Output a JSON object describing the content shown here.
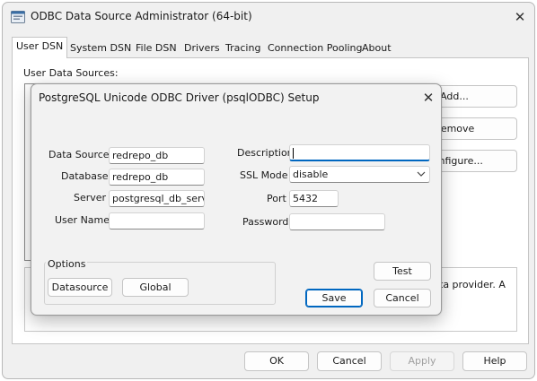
{
  "window": {
    "title": "ODBC Data Source Administrator (64-bit)",
    "close_glyph": "✕"
  },
  "tabs": [
    {
      "label": "User DSN"
    },
    {
      "label": "System DSN"
    },
    {
      "label": "File DSN"
    },
    {
      "label": "Drivers"
    },
    {
      "label": "Tracing"
    },
    {
      "label": "Connection Pooling"
    },
    {
      "label": "About"
    }
  ],
  "user_dsn": {
    "list_label": "User Data Sources:",
    "buttons": {
      "add_label": "Add...",
      "remove_label": "Remove",
      "configure_label": "Configure..."
    },
    "info_text_partial": "ta provider.  A"
  },
  "footer": {
    "ok_label": "OK",
    "cancel_label": "Cancel",
    "apply_label": "Apply",
    "help_label": "Help"
  },
  "dialog": {
    "title": "PostgreSQL Unicode ODBC Driver (psqlODBC) Setup",
    "close_glyph": "✕",
    "fields": {
      "data_source": {
        "label": "Data Source",
        "value": "redrepo_db"
      },
      "database": {
        "label": "Database",
        "value": "redrepo_db"
      },
      "server": {
        "label": "Server",
        "value": "postgresql_db_server"
      },
      "user_name": {
        "label": "User Name",
        "value": ""
      },
      "description": {
        "label": "Description",
        "value": ""
      },
      "ssl_mode": {
        "label": "SSL Mode",
        "value": "disable"
      },
      "port": {
        "label": "Port",
        "value": "5432"
      },
      "password": {
        "label": "Password",
        "value": ""
      }
    },
    "options": {
      "group_label": "Options",
      "datasource_label": "Datasource",
      "global_label": "Global"
    },
    "buttons": {
      "test_label": "Test",
      "save_label": "Save",
      "cancel_label": "Cancel"
    }
  },
  "icons": {
    "chevron_down": "chevron-down-icon",
    "app": "odbc-app-icon"
  },
  "colors": {
    "accent": "#0067c0",
    "window_bg": "#f0f0f0"
  }
}
